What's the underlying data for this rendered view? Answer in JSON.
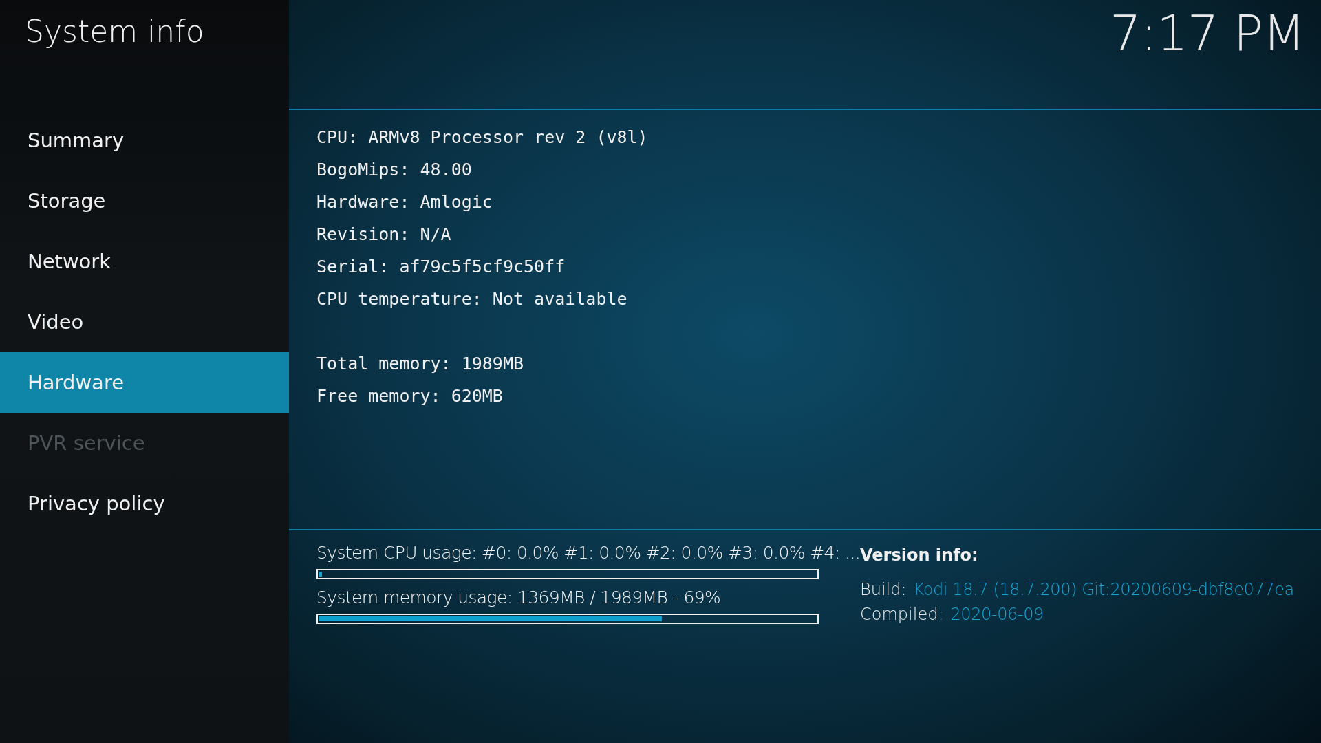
{
  "header": {
    "title": "System info",
    "clock": "7:17 PM"
  },
  "sidebar": {
    "items": [
      {
        "label": "Summary",
        "selected": false,
        "disabled": false
      },
      {
        "label": "Storage",
        "selected": false,
        "disabled": false
      },
      {
        "label": "Network",
        "selected": false,
        "disabled": false
      },
      {
        "label": "Video",
        "selected": false,
        "disabled": false
      },
      {
        "label": "Hardware",
        "selected": true,
        "disabled": false
      },
      {
        "label": "PVR service",
        "selected": false,
        "disabled": true
      },
      {
        "label": "Privacy policy",
        "selected": false,
        "disabled": false
      }
    ]
  },
  "info_lines": [
    [
      "CPU: ARMv8 Processor rev 2 (v8l)",
      "BogoMips: 48.00",
      "Hardware: Amlogic",
      "Revision: N/A",
      "Serial: af79c5f5cf9c50ff",
      "CPU temperature: Not available"
    ],
    [
      "Total memory: 1989MB",
      "Free memory: 620MB"
    ]
  ],
  "usage": [
    {
      "label": "System CPU usage: #0: 0.0% #1: 0.0% #2: 0.0% #3: 0.0% #4: ...",
      "level": 0.005
    },
    {
      "label": "System memory usage: 1369MB / 1989MB - 69%",
      "level": 0.69
    }
  ],
  "version_info": {
    "heading": "Version info:",
    "rows": [
      {
        "label": "Build:",
        "value": "Kodi 18.7 (18.7.200) Git:20200609-dbf8e077ea"
      },
      {
        "label": "Compiled:",
        "value": "2020-06-09"
      }
    ]
  }
}
